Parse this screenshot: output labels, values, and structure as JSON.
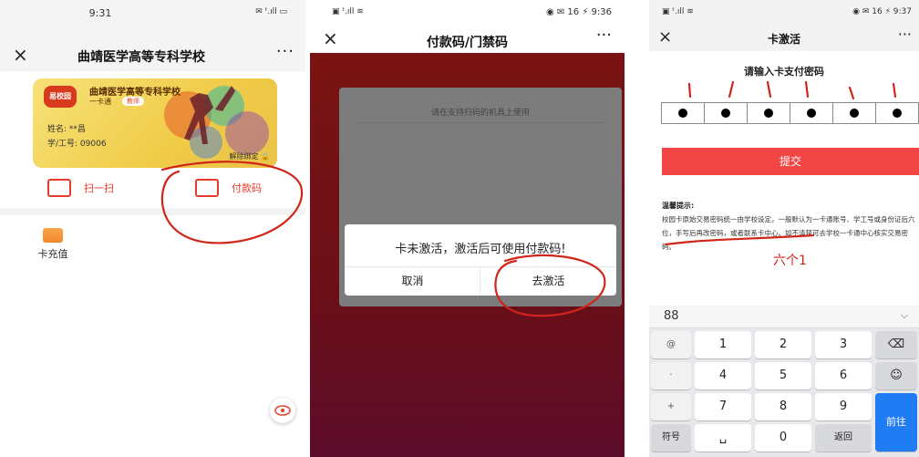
{
  "screen1": {
    "status": {
      "time": "9:31",
      "icons": "✉ ᵗ.ıll ▭"
    },
    "nav": {
      "close": "×",
      "title": "曲靖医学高等专科学校",
      "more": "···"
    },
    "card": {
      "logo": "易校园",
      "school": "曲靖医学高等专科学校",
      "type": "一卡通",
      "badge": "教师",
      "name": "姓名: **昌",
      "id": "学/工号: 09006",
      "unbind": "解除绑定"
    },
    "actions": [
      {
        "label": "扫一扫"
      },
      {
        "label": "付款码"
      }
    ],
    "recharge": "卡充值"
  },
  "screen2": {
    "status": {
      "left": "▣ ᵗ.ıll ≋",
      "right": "◉ ✉ 16 ⚡ 9:36"
    },
    "nav": {
      "close": "×",
      "title": "付款码/门禁码",
      "more": "···"
    },
    "panel_hint": "请在支持扫码的机具上使用",
    "dialog": {
      "message": "卡未激活，激活后可使用付款码!",
      "cancel": "取消",
      "confirm": "去激活"
    }
  },
  "screen3": {
    "status": {
      "left": "▣ ᵗ.ıll ≋",
      "right": "◉ ✉ 16 ⚡ 9:37"
    },
    "nav": {
      "close": "×",
      "title": "卡激活",
      "more": "···"
    },
    "prompt": "请输入卡支付密码",
    "submit": "提交",
    "tips_title": "温馨提示:",
    "tips_text": "校园卡原始交易密码统一由学校设定，一般默认为一卡通账号、学工号或身份证后六位，手写后再改密码，或者联系卡中心。如不清楚可去学校一卡通中心核实交易密码。",
    "annotation": "六个1",
    "keyboard": {
      "top_left": "88",
      "top_right": "⌵",
      "side": [
        "@",
        "·",
        "+",
        "-"
      ],
      "digits": [
        "1",
        "2",
        "3",
        "4",
        "5",
        "6",
        "7",
        "8",
        "9",
        "0"
      ],
      "backspace": "⌫",
      "emoji": "☺",
      "symbols": "符号",
      "back": "返回",
      "go": "前往"
    }
  }
}
